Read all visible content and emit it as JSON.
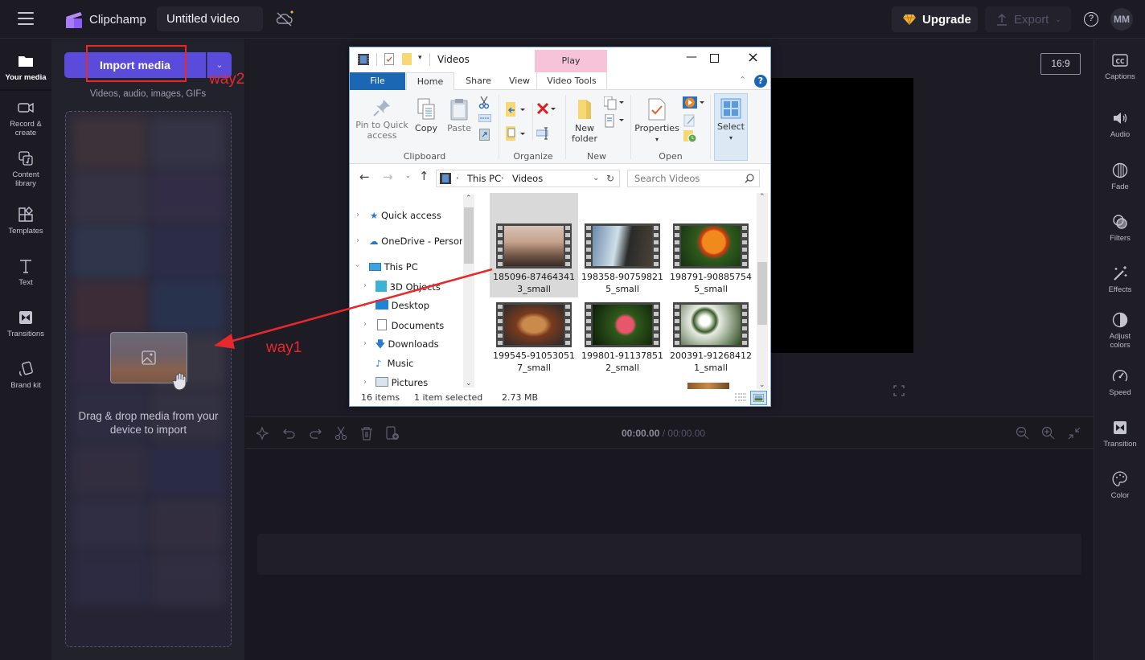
{
  "topbar": {
    "app_name": "Clipchamp",
    "project_title": "Untitled video",
    "upgrade_label": "Upgrade",
    "export_label": "Export",
    "help_label": "?",
    "avatar_initials": "MM"
  },
  "left_rail": {
    "items": [
      {
        "label": "Your media",
        "icon": "folder-icon",
        "active": true
      },
      {
        "label": "Record & create",
        "icon": "camera-icon"
      },
      {
        "label": "Content library",
        "icon": "content-library-icon"
      },
      {
        "label": "Templates",
        "icon": "templates-icon"
      },
      {
        "label": "Text",
        "icon": "text-icon"
      },
      {
        "label": "Transitions",
        "icon": "transitions-icon"
      },
      {
        "label": "Brand kit",
        "icon": "brand-kit-icon"
      }
    ]
  },
  "media_panel": {
    "import_label": "Import media",
    "subtitle": "Videos, audio, images, GIFs",
    "drop_text": "Drag & drop media from your device to import"
  },
  "preview": {
    "aspect_ratio": "16:9"
  },
  "timeline": {
    "current_time": "00:00.00",
    "separator": " / ",
    "total_time": "00:00.00"
  },
  "right_rail": {
    "items": [
      {
        "label": "Captions",
        "icon": "captions-icon"
      },
      {
        "label": "Audio",
        "icon": "speaker-icon"
      },
      {
        "label": "Fade",
        "icon": "fade-icon"
      },
      {
        "label": "Filters",
        "icon": "filters-icon"
      },
      {
        "label": "Effects",
        "icon": "magic-wand-icon"
      },
      {
        "label": "Adjust colors",
        "icon": "adjust-colors-icon"
      },
      {
        "label": "Speed",
        "icon": "speedometer-icon"
      },
      {
        "label": "Transition",
        "icon": "transition-icon"
      },
      {
        "label": "Color",
        "icon": "palette-icon"
      }
    ]
  },
  "annotations": {
    "way1": "way1",
    "way2": "way2",
    "color": "#e8282a"
  },
  "explorer": {
    "window_title": "Videos",
    "contextual_tab": "Play",
    "tabs": [
      "File",
      "Home",
      "Share",
      "View",
      "Video Tools"
    ],
    "ribbon": {
      "pin": "Pin to Quick access",
      "copy": "Copy",
      "paste": "Paste",
      "new_folder": "New folder",
      "properties": "Properties",
      "select": "Select",
      "groups": [
        "Clipboard",
        "Organize",
        "New",
        "Open"
      ]
    },
    "address": {
      "root": "This PC",
      "folder": "Videos"
    },
    "search_placeholder": "Search Videos",
    "nav": [
      {
        "label": "Quick access",
        "level": 0
      },
      {
        "label": "OneDrive - Personal",
        "level": 0
      },
      {
        "label": "This PC",
        "level": 0,
        "expanded": true
      },
      {
        "label": "3D Objects",
        "level": 1
      },
      {
        "label": "Desktop",
        "level": 1
      },
      {
        "label": "Documents",
        "level": 1
      },
      {
        "label": "Downloads",
        "level": 1
      },
      {
        "label": "Music",
        "level": 1
      },
      {
        "label": "Pictures",
        "level": 1
      }
    ],
    "files": [
      {
        "line1": "185096-87464341",
        "line2": "3_small",
        "selected": true
      },
      {
        "line1": "198358-90759821",
        "line2": "5_small"
      },
      {
        "line1": "198791-90885754",
        "line2": "5_small"
      },
      {
        "line1": "199545-91053051",
        "line2": "7_small"
      },
      {
        "line1": "199801-91137851",
        "line2": "2_small"
      },
      {
        "line1": "200391-91268412",
        "line2": "1_small"
      }
    ],
    "status": {
      "count": "16 items",
      "selection": "1 item selected",
      "size": "2.73 MB"
    }
  }
}
